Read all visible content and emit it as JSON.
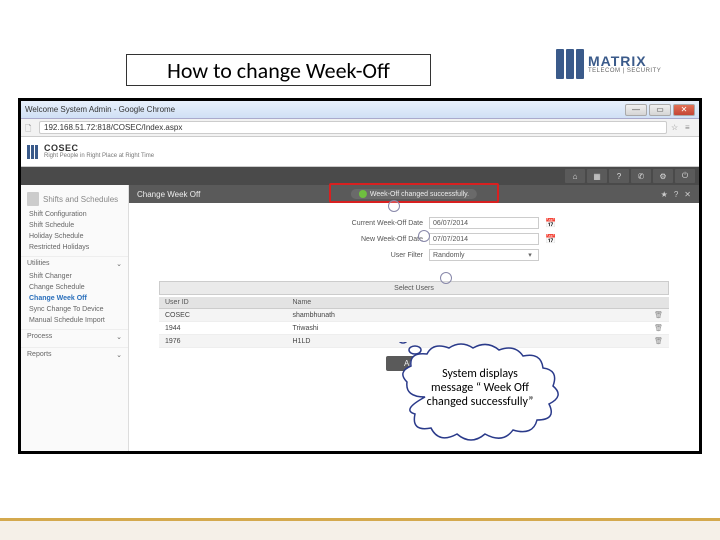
{
  "slide": {
    "title": "How to change Week-Off"
  },
  "logo": {
    "main": "MATRIX",
    "sub": "TELECOM | SECURITY"
  },
  "chrome": {
    "title": "Welcome System Admin - Google Chrome",
    "url": "192.168.51.72:818/COSEC/Index.aspx"
  },
  "app": {
    "brand": "COSEC",
    "tagline": "Right People in Right Place at Right Time"
  },
  "panel": {
    "title": "Change Week Off",
    "success_msg": "Week-Off changed successfully."
  },
  "form": {
    "current_label": "Current Week-Off Date",
    "current_value": "06/07/2014",
    "new_label": "New Week-Off Date",
    "new_value": "07/07/2014",
    "filter_label": "User Filter",
    "filter_value": "Randomly",
    "select_users": "Select Users",
    "apply": "Apply"
  },
  "table": {
    "cols": [
      "User ID",
      "Name"
    ],
    "rows": [
      {
        "id": "COSEC",
        "name": "shambhunath"
      },
      {
        "id": "1944",
        "name": "Triwashi"
      },
      {
        "id": "1976",
        "name": "H1LD"
      }
    ]
  },
  "sidebar": {
    "section": "Shifts and Schedules",
    "items": [
      {
        "label": "Shift Configuration",
        "active": false
      },
      {
        "label": "Shift Schedule",
        "active": false
      },
      {
        "label": "Holiday Schedule",
        "active": false
      },
      {
        "label": "Restricted Holidays",
        "active": false
      }
    ],
    "utilities_label": "Utilities",
    "utilities": [
      {
        "label": "Shift Changer",
        "active": false
      },
      {
        "label": "Change Schedule",
        "active": false
      },
      {
        "label": "Change Week Off",
        "active": true
      },
      {
        "label": "Sync Change To Device",
        "active": false
      },
      {
        "label": "Manual Schedule Import",
        "active": false
      }
    ],
    "process_label": "Process",
    "reports_label": "Reports"
  },
  "callout": {
    "text": "System displays message “ Week Off changed successfully”"
  }
}
